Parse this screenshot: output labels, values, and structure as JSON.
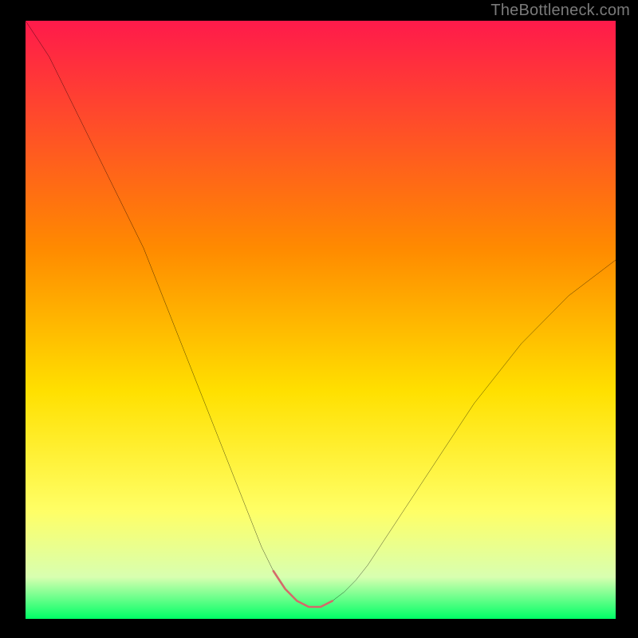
{
  "watermark": "TheBottleneck.com",
  "colors": {
    "bg": "#000000",
    "curve": "#000000",
    "highlight": "#d46a6a",
    "gradient_top": "#ff1a4b",
    "gradient_mid": "#ffb000",
    "gradient_low": "#ffff33",
    "gradient_bottom": "#00ff66"
  },
  "chart_data": {
    "type": "line",
    "title": "",
    "xlabel": "",
    "ylabel": "",
    "xlim": [
      0,
      100
    ],
    "ylim": [
      0,
      100
    ],
    "legend": false,
    "grid": false,
    "x": [
      0,
      2,
      4,
      6,
      8,
      10,
      12,
      14,
      16,
      18,
      20,
      22,
      24,
      26,
      28,
      30,
      32,
      34,
      36,
      38,
      40,
      42,
      43,
      44,
      45,
      46,
      47,
      48,
      49,
      50,
      51,
      52,
      54,
      56,
      58,
      60,
      62,
      64,
      66,
      68,
      70,
      72,
      74,
      76,
      78,
      80,
      82,
      84,
      86,
      88,
      90,
      92,
      94,
      96,
      98,
      100
    ],
    "values": [
      100,
      97,
      94,
      90,
      86,
      82,
      78,
      74,
      70,
      66,
      62,
      57,
      52,
      47,
      42,
      37,
      32,
      27,
      22,
      17,
      12,
      8,
      6.5,
      5,
      4,
      3,
      2.5,
      2,
      2,
      2,
      2.5,
      3,
      4.5,
      6.5,
      9,
      12,
      15,
      18,
      21,
      24,
      27,
      30,
      33,
      36,
      38.5,
      41,
      43.5,
      46,
      48,
      50,
      52,
      54,
      55.5,
      57,
      58.5,
      60
    ],
    "annotations": [
      {
        "type": "highlight_segment",
        "x_start": 42,
        "x_end": 52,
        "description": "rounded pink highlight along curve minimum"
      }
    ]
  }
}
